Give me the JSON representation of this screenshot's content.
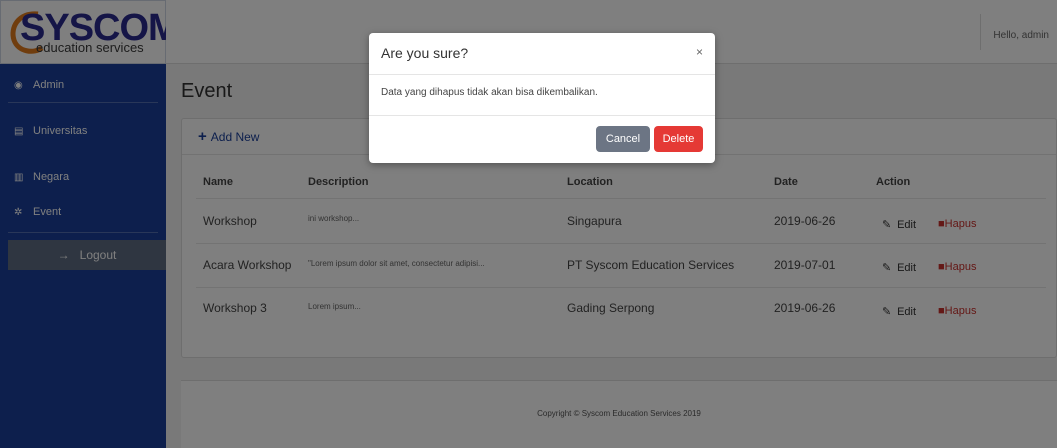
{
  "logo": {
    "brand": "SYSCOM",
    "sub": "education services"
  },
  "sidebar": {
    "items": [
      {
        "label": "Admin",
        "icon": "dashboard-icon"
      },
      {
        "label": "Universitas",
        "icon": "list-icon"
      },
      {
        "label": "Negara",
        "icon": "bars-icon"
      },
      {
        "label": "Event",
        "icon": "gear-icon"
      }
    ],
    "logout": "Logout"
  },
  "topbar": {
    "greeting": "Hello, admin"
  },
  "page": {
    "title": "Event"
  },
  "card": {
    "add_new": "Add New"
  },
  "table": {
    "headers": [
      "Name",
      "Description",
      "Location",
      "Date",
      "Action"
    ],
    "rows": [
      {
        "name": "Workshop",
        "description": "ini workshop...",
        "location": "Singapura",
        "date": "2019-06-26"
      },
      {
        "name": "Acara Workshop",
        "description": "\"Lorem ipsum dolor sit amet, consectetur adipisi...",
        "location": "PT Syscom Education Services",
        "date": "2019-07-01"
      },
      {
        "name": "Workshop 3",
        "description": "Lorem ipsum...",
        "location": "Gading Serpong",
        "date": "2019-06-26"
      }
    ],
    "edit_label": "Edit",
    "delete_label": "Hapus"
  },
  "footer": {
    "text": "Copyright © Syscom Education Services 2019"
  },
  "modal": {
    "title": "Are you sure?",
    "close": "×",
    "message": "Data yang dihapus tidak akan bisa dikembalikan.",
    "cancel": "Cancel",
    "delete": "Delete"
  },
  "colors": {
    "sidebar": "#1a3f9a",
    "danger": "#e53935",
    "secondary": "#6c7584",
    "brand_blue": "#2b2b8f",
    "brand_orange": "#e07b1c"
  }
}
